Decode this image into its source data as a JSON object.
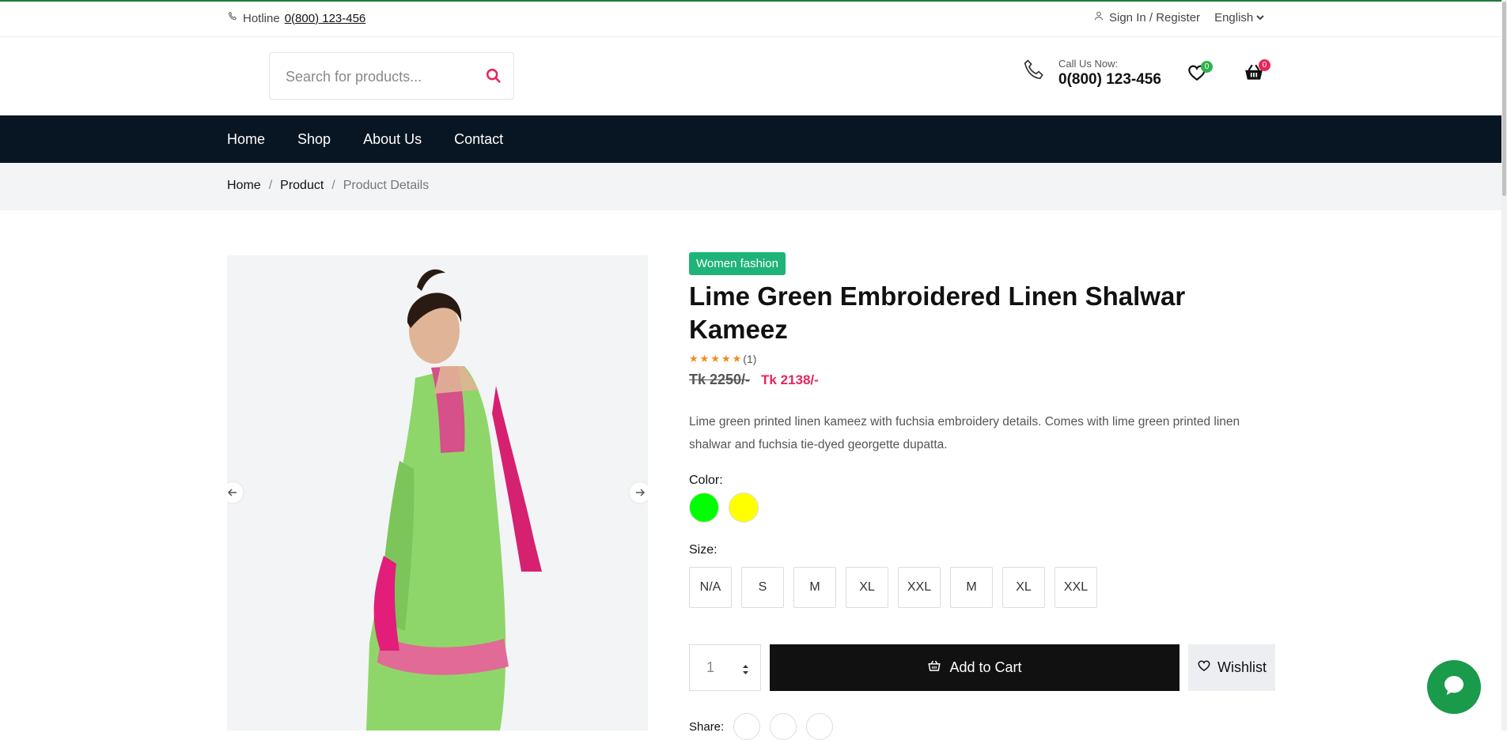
{
  "topbar": {
    "hotline_label": "Hotline",
    "hotline_number": "0(800) 123-456",
    "signin": "Sign In / Register",
    "language": "English"
  },
  "header": {
    "search_placeholder": "Search for products...",
    "call_label": "Call Us Now:",
    "call_number": "0(800) 123-456",
    "wishlist_count": "0",
    "cart_count": "0"
  },
  "nav": {
    "items": [
      "Home",
      "Shop",
      "About Us",
      "Contact"
    ]
  },
  "breadcrumb": {
    "items": [
      "Home",
      "Product",
      "Product Details"
    ]
  },
  "product": {
    "category": "Women fashion",
    "title": "Lime Green Embroidered Linen Shalwar Kameez",
    "rating_stars": 5,
    "rating_count": "(1)",
    "old_price": "Tk 2250/-",
    "new_price": "Tk 2138/-",
    "description": "Lime green printed linen kameez with fuchsia embroidery details. Comes with lime green printed linen shalwar and fuchsia tie-dyed georgette dupatta.",
    "color_label": "Color:",
    "colors": [
      "#00ff00",
      "#ffff00"
    ],
    "size_label": "Size:",
    "sizes": [
      "N/A",
      "S",
      "M",
      "XL",
      "XXL",
      "M",
      "XL",
      "XXL"
    ],
    "quantity": "1",
    "add_to_cart": "Add to Cart",
    "wishlist": "Wishlist",
    "share_label": "Share:"
  },
  "colors": {
    "nav_bg": "#081522",
    "accent": "#e8255a",
    "category_badge": "#1fb477",
    "wishlist_badge": "#2db34a",
    "chat": "#1a9a4b"
  }
}
